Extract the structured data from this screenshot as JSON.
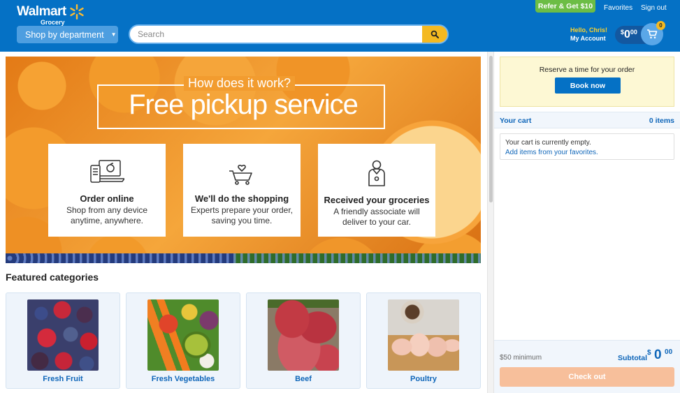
{
  "header": {
    "logo_main": "Walmart",
    "logo_sub": "Grocery",
    "shop_by_department": "Shop by department",
    "search_placeholder": "Search",
    "refer": "Refer & Get $10",
    "favorites": "Favorites",
    "sign_out": "Sign out",
    "greeting": "Hello, Chris!",
    "my_account": "My Account",
    "cart_total": {
      "dollar_sign": "$",
      "dollars": "0",
      "cents": "00"
    },
    "cart_badge": "0"
  },
  "hero": {
    "question": "How does it work?",
    "title": "Free pickup service",
    "cards": [
      {
        "title": "Order online",
        "desc": "Shop from any device anytime, anywhere."
      },
      {
        "title": "We'll do the shopping",
        "desc": "Experts prepare your order, saving you time."
      },
      {
        "title": "Received your groceries",
        "desc": "A friendly associate will deliver to your car."
      }
    ]
  },
  "featured": {
    "title": "Featured categories",
    "categories": [
      {
        "label": "Fresh Fruit"
      },
      {
        "label": "Fresh Vegetables"
      },
      {
        "label": "Beef"
      },
      {
        "label": "Poultry"
      }
    ]
  },
  "sidebar": {
    "reserve_text": "Reserve a time for your order",
    "book_now": "Book now",
    "cart_title": "Your cart",
    "cart_count": "0 items",
    "empty_text": "Your cart is currently empty.",
    "add_favorites": "Add items from your favorites.",
    "minimum": "$50 minimum",
    "subtotal_label": "Subtotal",
    "subtotal": {
      "dollar_sign": "$",
      "dollars": "0",
      "cents": "00"
    },
    "checkout": "Check out"
  },
  "colors": {
    "header_blue": "#0571c5",
    "accent_yellow": "#f4b921",
    "refer_green": "#6cbd45",
    "link_blue": "#0f66b9",
    "checkout_disabled": "#f7bf9b"
  }
}
